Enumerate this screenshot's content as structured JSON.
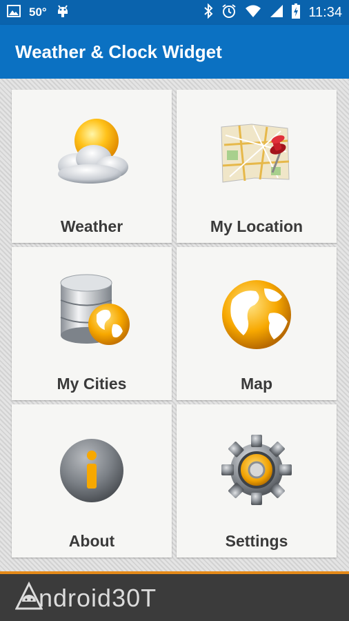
{
  "status_bar": {
    "temperature": "50°",
    "time": "11:34",
    "background": "#0a63ad"
  },
  "app_bar": {
    "title": "Weather & Clock Widget",
    "background": "#0b71c2"
  },
  "tiles": [
    {
      "label": "Weather",
      "icon": "weather-sun-cloud-icon"
    },
    {
      "label": "My Location",
      "icon": "map-pin-icon"
    },
    {
      "label": "My Cities",
      "icon": "database-globe-icon"
    },
    {
      "label": "Map",
      "icon": "globe-icon"
    },
    {
      "label": "About",
      "icon": "info-icon"
    },
    {
      "label": "Settings",
      "icon": "gear-icon"
    }
  ],
  "watermark": {
    "text": "ndroid30T",
    "accent": "#e48a1a"
  }
}
